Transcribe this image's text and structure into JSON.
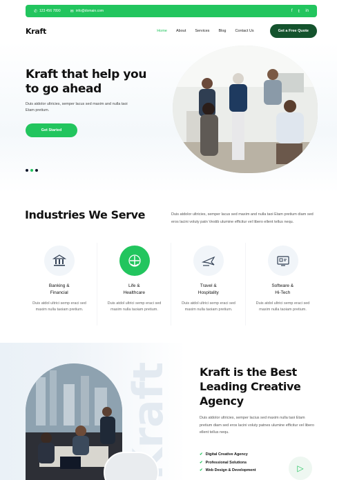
{
  "topbar": {
    "phone": "123 456 7890",
    "email": "info@domain.com",
    "phone_icon": "phone-icon",
    "email_icon": "mail-icon",
    "socials": [
      "f",
      "𝕥",
      "in"
    ]
  },
  "header": {
    "logo": "Kraft",
    "nav": [
      "Home",
      "About",
      "Services",
      "Blog",
      "Contact Us"
    ],
    "quote_button": "Get a Free Quote"
  },
  "hero": {
    "title": "Kraft that help you to go ahead",
    "description": "Duis atdolor ultricies, semper lacus sed maxim and nulla taoi Etam pretium.",
    "cta": "Get Started"
  },
  "industries": {
    "title": "Industries We Serve",
    "description": "Duis atdolor ultricies, semper lacus sed maxim and nulla taoi Etam pretium diam sed eros lacini voluty patn Vestib ulumine efficitur vel libero ellent tellus nequ.",
    "cards": [
      {
        "title": "Banking &\nFinancial",
        "desc": "Duis atdol ultrici semp eraci sed maxim nulla taoiam pretium.",
        "icon": "bank-icon"
      },
      {
        "title": "Life &\nHealthcare",
        "desc": "Duis atdol ultrici semp eraci sed maxim nulla taoiam pretium.",
        "icon": "healthcare-icon"
      },
      {
        "title": "Travel &\nHospitality",
        "desc": "Duis atdol ultrici semp eraci sed maxim nulla taoiam pretium.",
        "icon": "airplane-icon"
      },
      {
        "title": "Software &\nHi-Tech",
        "desc": "Duis atdol ultrici semp eraci sed maxim nulla taoiam pretium.",
        "icon": "software-icon"
      }
    ]
  },
  "about": {
    "ghost_text": "Kraft",
    "title": "Kraft is the Best Leading Creative Agency",
    "description": "Duis atdolor ultricies, semper lacius sed maxim nulla taoi Etam pretium diam sed eros lacini voluty patnes ulumine efficitur vel libero ellent tellus nequ.",
    "features": [
      "Digital Creative Agency",
      "Professional Solutions",
      "Web Design & Development"
    ]
  },
  "colors": {
    "accent": "#22c55e",
    "dark_green": "#14532d"
  }
}
